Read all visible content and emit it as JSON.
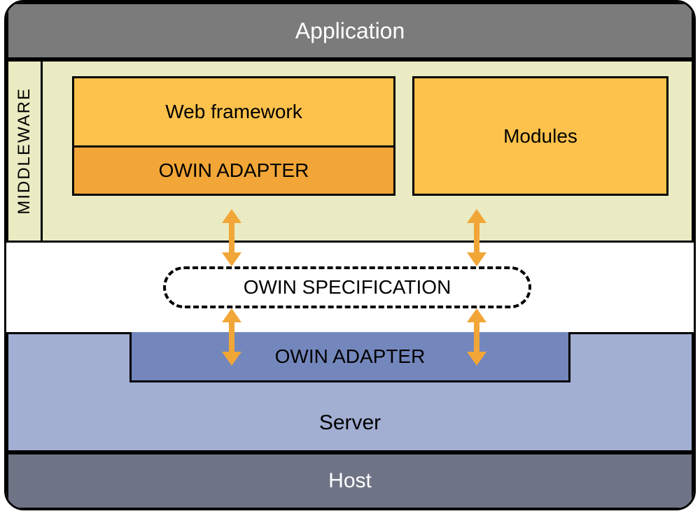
{
  "application": {
    "label": "Application"
  },
  "middleware": {
    "side_label": "MIDDLEWARE",
    "web_framework": "Web framework",
    "owin_adapter": "OWIN ADAPTER",
    "modules": "Modules"
  },
  "spec": {
    "label": "OWIN SPECIFICATION"
  },
  "server": {
    "label": "Server",
    "owin_adapter": "OWIN ADAPTER"
  },
  "host": {
    "label": "Host"
  },
  "colors": {
    "app_bar": "#7b7b7b",
    "middleware_bg": "#eaebc2",
    "block_light": "#fdc24c",
    "block_dark": "#f2a637",
    "server_bg": "#a2aed2",
    "server_adapter": "#7487bd",
    "host_bar": "#6f7386",
    "arrow": "#f2a637"
  }
}
